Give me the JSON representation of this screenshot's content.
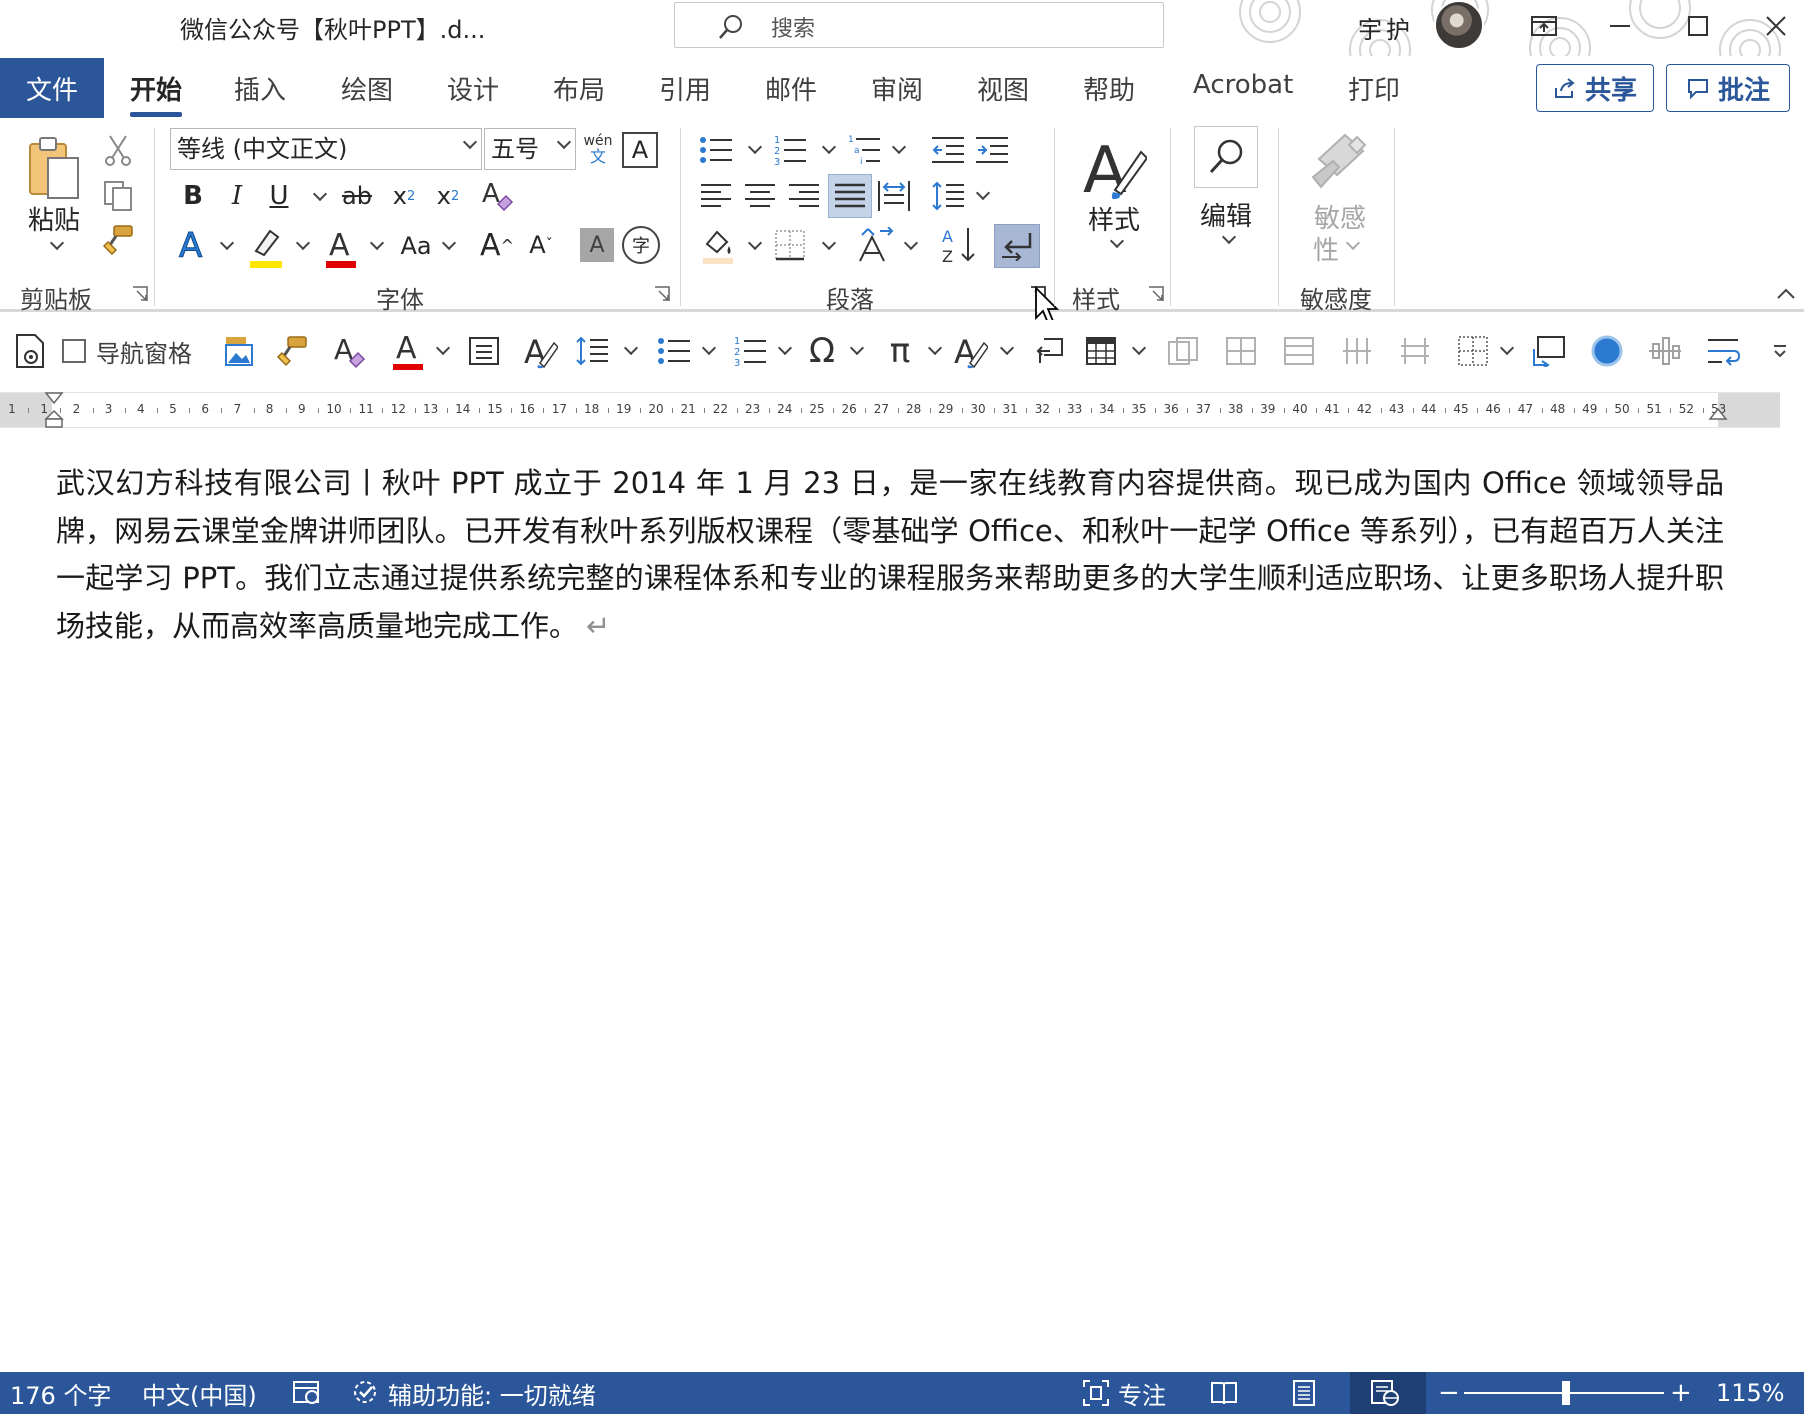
{
  "titlebar": {
    "doc_title": "微信公众号【秋叶PPT】.d...",
    "search_placeholder": "搜索",
    "user_name": "宇护"
  },
  "tabs": {
    "file": "文件",
    "items": [
      "开始",
      "插入",
      "绘图",
      "设计",
      "布局",
      "引用",
      "邮件",
      "审阅",
      "视图",
      "帮助",
      "Acrobat",
      "打印"
    ],
    "active": "开始",
    "share": "共享",
    "comment": "批注"
  },
  "ribbon": {
    "clipboard": {
      "paste": "粘贴",
      "group": "剪贴板"
    },
    "font": {
      "font_name": "等线 (中文正文)",
      "font_size": "五号",
      "group": "字体",
      "phonetic_top": "wén",
      "phonetic_bottom": "文",
      "bold": "B",
      "italic": "I",
      "underline": "U",
      "strike": "ab",
      "change_case": "Aa",
      "grow": "A",
      "shrink": "A",
      "enclosed": "字"
    },
    "paragraph": {
      "group": "段落"
    },
    "styles": {
      "label": "样式",
      "group": "样式"
    },
    "editing": {
      "label": "编辑"
    },
    "sensitivity": {
      "label_line1": "敏感",
      "label_line2": "性",
      "group": "敏感度"
    }
  },
  "qat": {
    "nav_pane": "导航窗格"
  },
  "ruler": {
    "labels": [
      "1",
      "1",
      "2",
      "3",
      "4",
      "5",
      "6",
      "7",
      "8",
      "9",
      "10",
      "11",
      "12",
      "13",
      "14",
      "15",
      "16",
      "17",
      "18",
      "19",
      "20",
      "21",
      "22",
      "23",
      "24",
      "25",
      "26",
      "27",
      "28",
      "29",
      "30",
      "31",
      "32",
      "33",
      "34",
      "35",
      "36",
      "37",
      "38",
      "39",
      "40",
      "41",
      "42",
      "43",
      "44",
      "45",
      "46",
      "47",
      "48",
      "49",
      "50",
      "51",
      "52",
      "53"
    ]
  },
  "document": {
    "paragraph": "武汉幻方科技有限公司丨秋叶 PPT 成立于 2014 年 1 月 23 日，是一家在线教育内容提供商。现已成为国内 Office 领域领导品牌，网易云课堂金牌讲师团队。已开发有秋叶系列版权课程（零基础学 Office、和秋叶一起学 Office 等系列），已有超百万人关注一起学习 PPT。我们立志通过提供系统完整的课程体系和专业的课程服务来帮助更多的大学生顺利适应职场、让更多职场人提升职场技能，从而高效率高质量地完成工作。",
    "para_mark": "↵"
  },
  "statusbar": {
    "word_count": "176 个字",
    "language": "中文(中国)",
    "accessibility": "辅助功能: 一切就绪",
    "focus": "专注",
    "zoom": "115%"
  },
  "colors": {
    "accent": "#2b579a",
    "status_dark": "#1e3f73",
    "font_color_red": "#e00000",
    "highlight_yellow": "#ffe600"
  },
  "icons": [
    "search-icon",
    "restore-icon",
    "minimize-icon",
    "maximize-icon",
    "close-icon",
    "share-icon",
    "comment-icon",
    "paste-icon",
    "cut-icon",
    "copy-icon",
    "format-painter-icon",
    "bullets-icon",
    "numbering-icon",
    "multilevel-list-icon",
    "decrease-indent-icon",
    "increase-indent-icon",
    "align-left-icon",
    "center-icon",
    "align-right-icon",
    "justify-icon",
    "distributed-icon",
    "line-spacing-icon",
    "shading-icon",
    "borders-icon",
    "chinese-layout-icon",
    "sort-icon",
    "show-marks-icon",
    "styles-icon",
    "find-icon",
    "sensitivity-icon"
  ]
}
